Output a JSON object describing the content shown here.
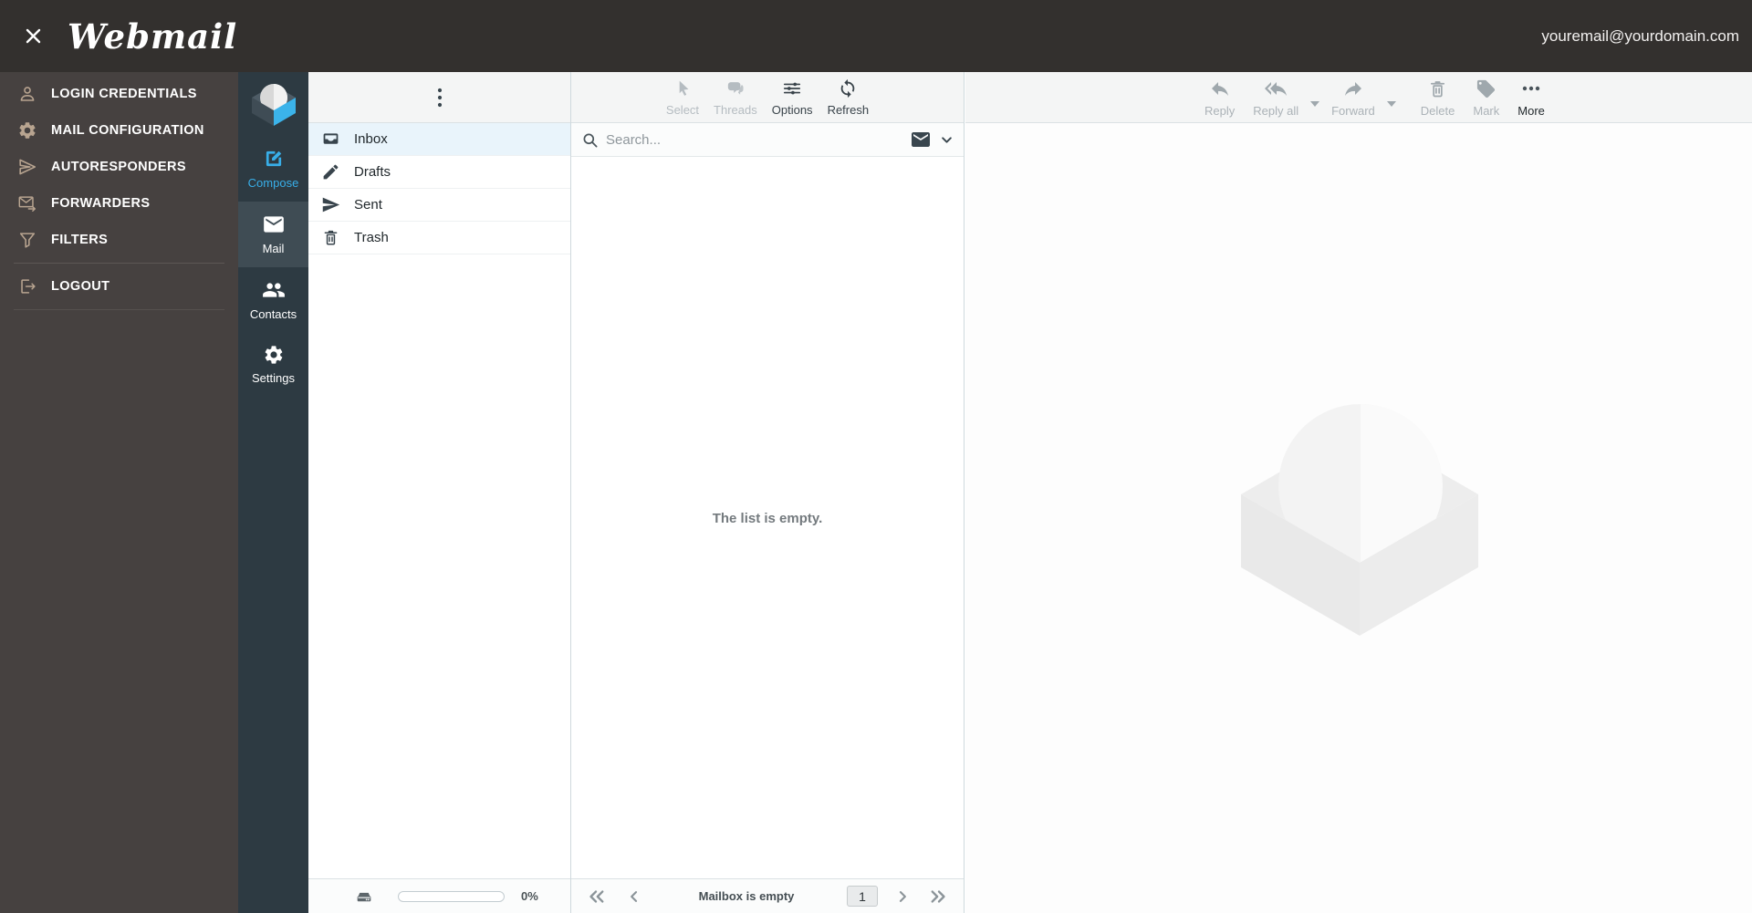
{
  "topbar": {
    "app_title": "Webmail",
    "user_email": "youremail@yourdomain.com",
    "close_icon": "close-icon"
  },
  "sidebar": {
    "items": [
      {
        "label": "LOGIN CREDENTIALS",
        "icon": "user-icon"
      },
      {
        "label": "MAIL CONFIGURATION",
        "icon": "gear-icon"
      },
      {
        "label": "AUTORESPONDERS",
        "icon": "paper-plane-icon"
      },
      {
        "label": "FORWARDERS",
        "icon": "envelope-arrow-icon"
      },
      {
        "label": "FILTERS",
        "icon": "funnel-icon"
      },
      {
        "label": "LOGOUT",
        "icon": "logout-icon"
      }
    ]
  },
  "taskmenu": {
    "logo_icon": "cube-sphere-logo",
    "items": [
      {
        "label": "Compose",
        "icon": "compose-icon",
        "active": false
      },
      {
        "label": "Mail",
        "icon": "mail-icon",
        "active": true
      },
      {
        "label": "Contacts",
        "icon": "contacts-icon",
        "active": false
      },
      {
        "label": "Settings",
        "icon": "settings-icon",
        "active": false
      }
    ]
  },
  "folders": {
    "menu_icon": "kebab-icon",
    "items": [
      {
        "name": "Inbox",
        "icon": "inbox-icon",
        "active": true
      },
      {
        "name": "Drafts",
        "icon": "pencil-icon",
        "active": false
      },
      {
        "name": "Sent",
        "icon": "send-icon",
        "active": false
      },
      {
        "name": "Trash",
        "icon": "trash-icon",
        "active": false
      }
    ],
    "quota": {
      "percent": 0,
      "percent_label": "0%",
      "icon": "storage-icon"
    }
  },
  "message_list": {
    "toolbar": [
      {
        "label": "Select",
        "icon": "cursor-icon",
        "enabled": false
      },
      {
        "label": "Threads",
        "icon": "threads-icon",
        "enabled": false
      },
      {
        "label": "Options",
        "icon": "options-icon",
        "enabled": true
      },
      {
        "label": "Refresh",
        "icon": "refresh-icon",
        "enabled": true
      }
    ],
    "search": {
      "placeholder": "Search...",
      "value": "",
      "scope_icon": "envelope-icon",
      "caret_icon": "chevron-down-icon"
    },
    "empty_text": "The list is empty.",
    "pagination": {
      "first_icon": "first-page-icon",
      "prev_icon": "prev-page-icon",
      "status": "Mailbox is empty",
      "page": "1",
      "next_icon": "next-page-icon",
      "last_icon": "last-page-icon"
    }
  },
  "content": {
    "toolbar": [
      {
        "label": "Reply",
        "icon": "reply-icon",
        "enabled": false
      },
      {
        "label": "Reply all",
        "icon": "reply-all-icon",
        "enabled": false,
        "has_menu": true
      },
      {
        "label": "Forward",
        "icon": "forward-icon",
        "enabled": false,
        "has_menu": true
      },
      {
        "label": "Delete",
        "icon": "delete-icon",
        "enabled": false
      },
      {
        "label": "Mark",
        "icon": "tag-icon",
        "enabled": false
      },
      {
        "label": "More",
        "icon": "more-icon",
        "enabled": true
      }
    ],
    "watermark_icon": "cube-sphere-watermark"
  },
  "colors": {
    "topbar_bg": "#33302e",
    "sidebar_bg": "#464140",
    "sidebar_icon": "#b8a490",
    "taskmenu_bg": "#2d3a42",
    "taskmenu_active_bg": "#3f4c54",
    "accent_blue": "#38aee8",
    "active_folder_bg": "#e9f4fb",
    "toolbar_bg": "#f4f5f5",
    "column_border": "#cfd9dd"
  }
}
